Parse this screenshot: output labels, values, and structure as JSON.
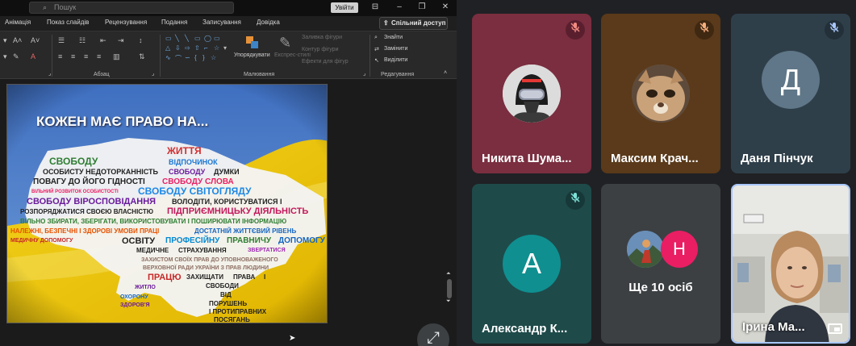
{
  "ppt": {
    "search_placeholder": "Пошук",
    "signin_label": "Увійти",
    "share_label": "Спільний доступ",
    "tabs": [
      "Анімація",
      "Показ слайдів",
      "Рецензування",
      "Подання",
      "Записування",
      "Довідка"
    ],
    "ribbon": {
      "group_paragraph": "Абзац",
      "group_drawing": "Малювання",
      "group_editing": "Редагування",
      "arrange": "Упорядкувати",
      "quick_styles": "Експрес-стилі",
      "shape_fill": "Заливка фігури",
      "shape_outline": "Контур фігури",
      "shape_effects": "Ефекти для фігур",
      "find": "Знайти",
      "replace": "Замінити",
      "select": "Виділити"
    },
    "slide": {
      "title": "КОЖЕН МАЄ ПРАВО НА..."
    }
  },
  "meet": {
    "tiles": [
      {
        "name": "Никита Шума...",
        "bg": "#7a2e3f",
        "mute_bg": "#5a1f2e",
        "avatar_type": "photo"
      },
      {
        "name": "Максим Крач...",
        "bg": "#5a3a1a",
        "mute_bg": "#3f2812",
        "avatar_type": "photo"
      },
      {
        "name": "Даня Пінчук",
        "bg": "#2f3f4a",
        "mute_bg": "#243039",
        "avatar_letter": "Д",
        "avatar_bg": "#5f7788"
      },
      {
        "name": "Александр К...",
        "bg": "#1f4a4a",
        "mute_bg": "#173838",
        "avatar_letter": "А",
        "avatar_bg": "#0f8f90"
      },
      {
        "name": "Ще 10 осіб",
        "bg": "#3c4043",
        "second_letter": "Н",
        "second_bg": "#e91e63"
      },
      {
        "name": "Ірина Ма...",
        "bg": "#c9c9c2"
      }
    ]
  }
}
